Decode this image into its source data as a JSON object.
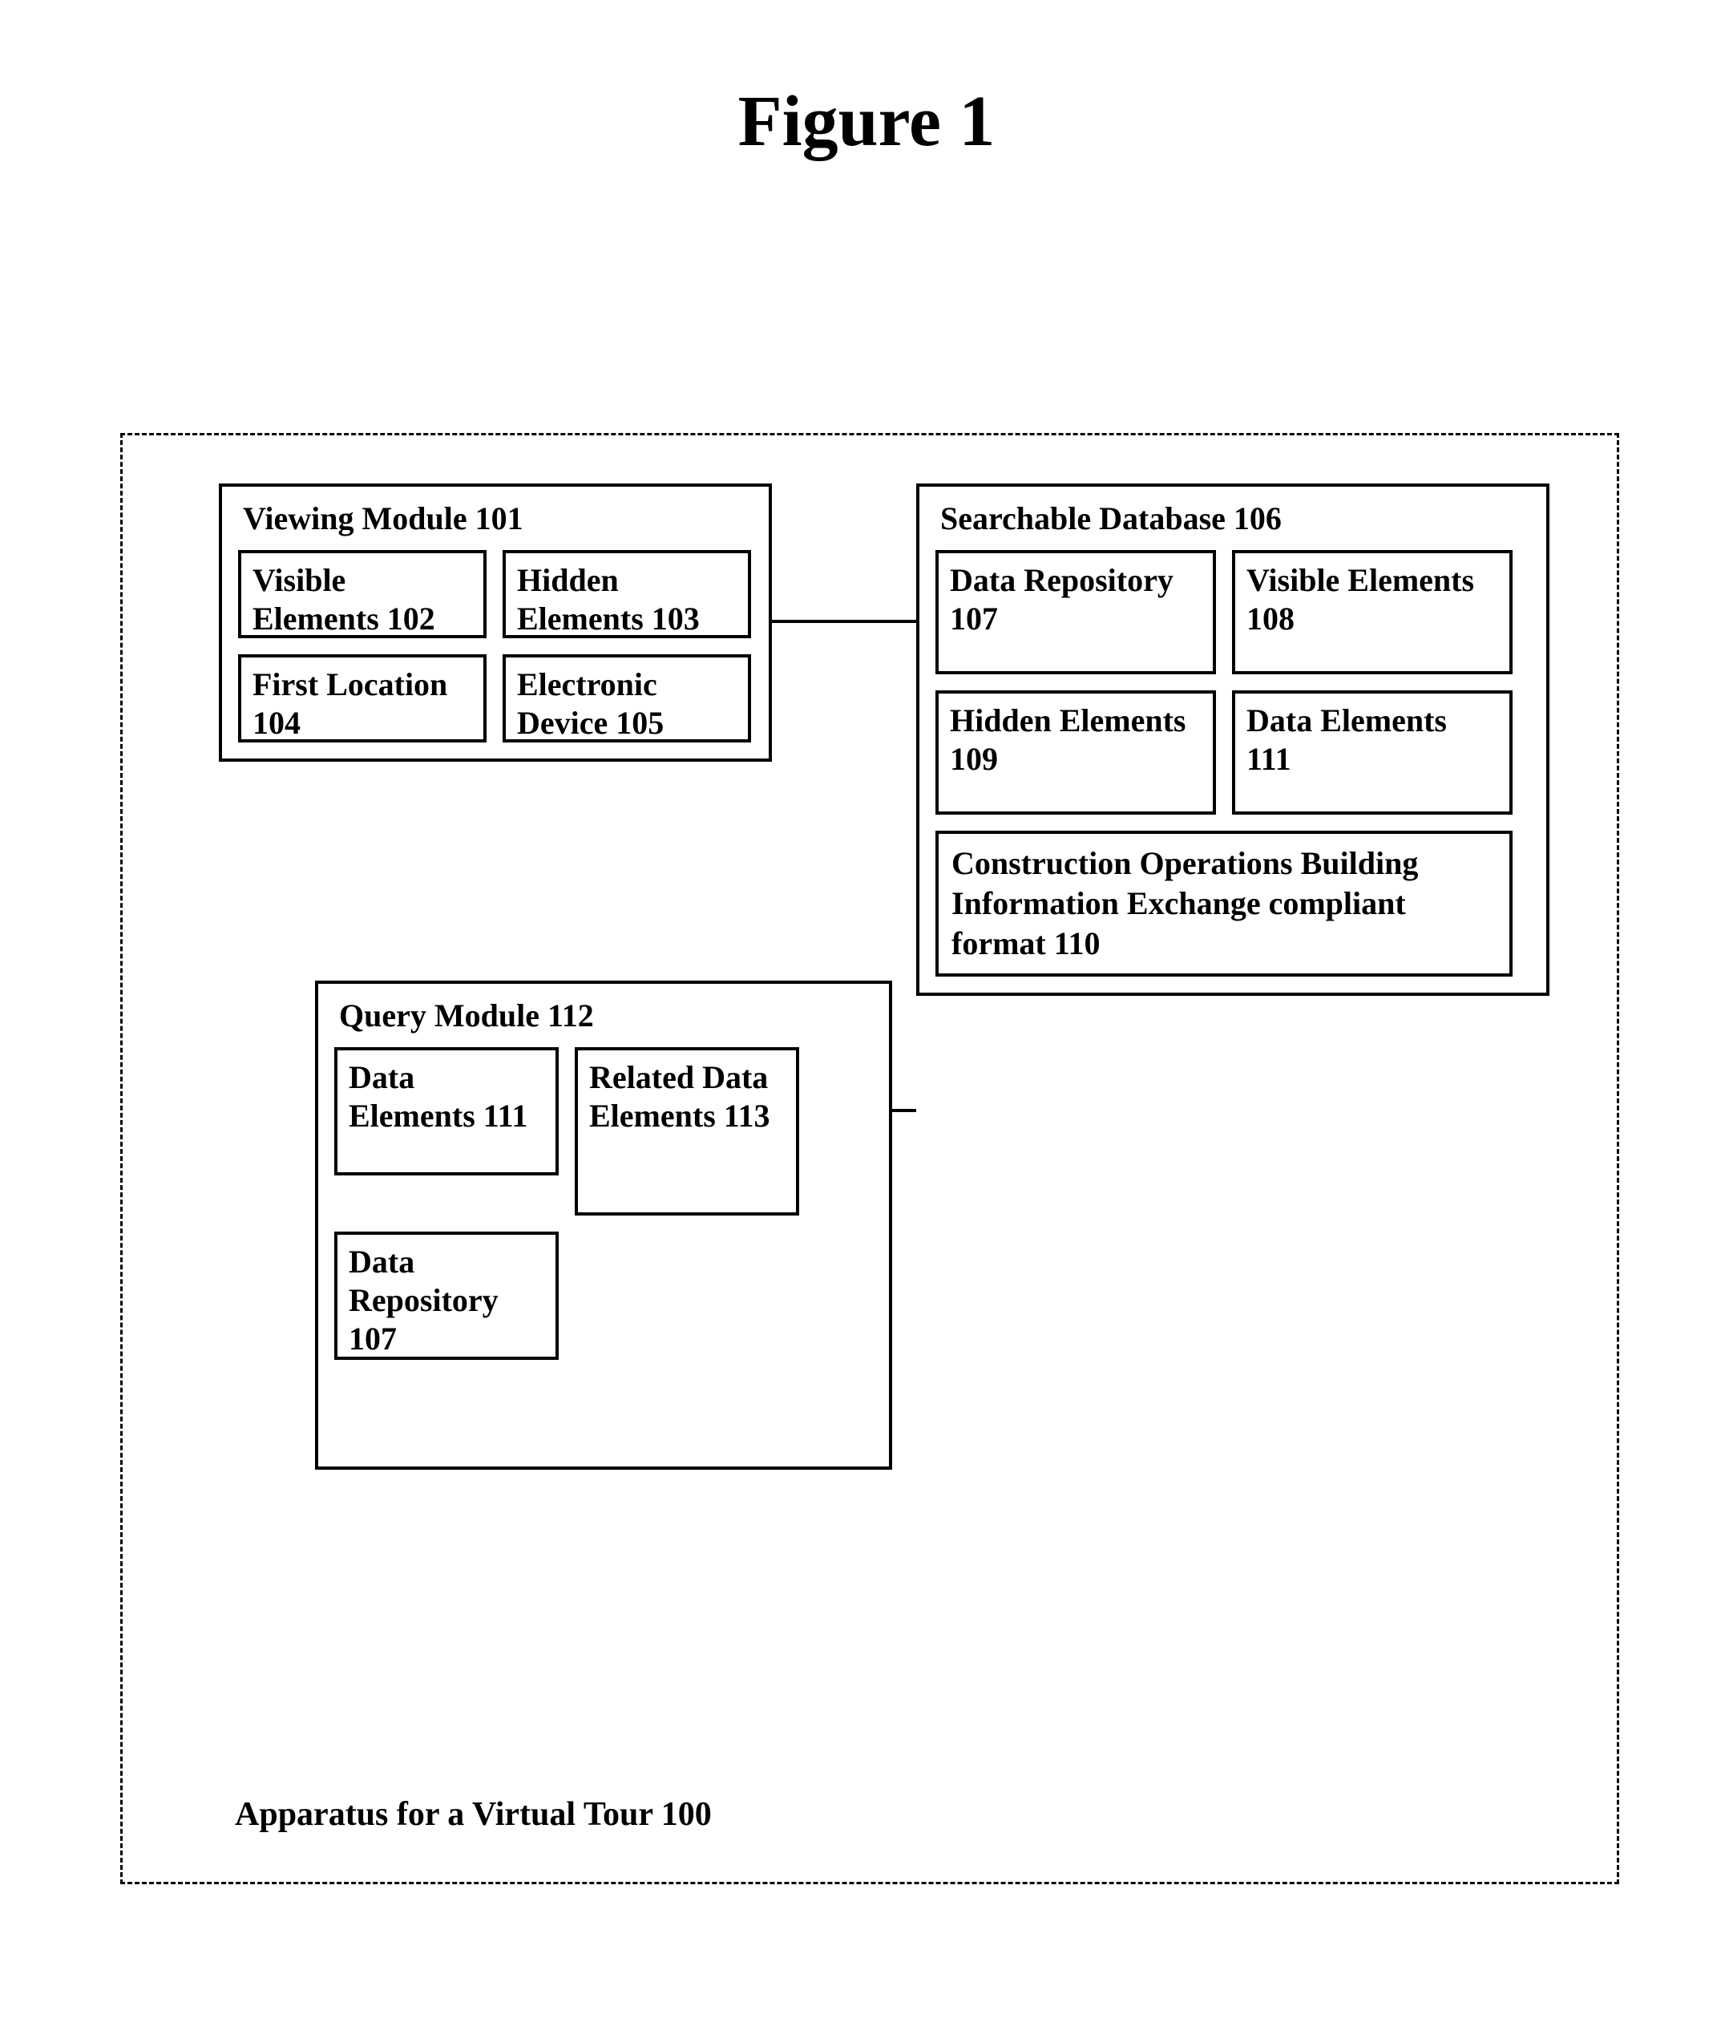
{
  "title": "Figure 1",
  "apparatus_label": "Apparatus for a Virtual Tour 100",
  "viewing_module": {
    "title": "Viewing Module 101",
    "boxes": [
      "Visible Elements 102",
      "Hidden Elements 103",
      "First Location 104",
      "Electronic Device 105"
    ]
  },
  "searchable_database": {
    "title": "Searchable Database 106",
    "boxes": [
      "Data Repository 107",
      "Visible Elements 108",
      "Hidden Elements 109",
      "Data Elements 111"
    ],
    "wide_box": "Construction Operations Building Information Exchange compliant format 110"
  },
  "query_module": {
    "title": "Query Module 112",
    "boxes": [
      "Data Elements 111",
      "Related Data Elements 113",
      "Data Repository 107"
    ]
  }
}
